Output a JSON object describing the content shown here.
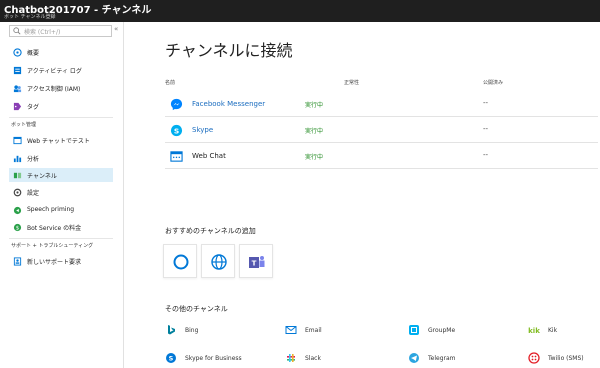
{
  "header": {
    "title": "Chatbot201707 - チャンネル",
    "subtitle": "ボット チャンネル登録"
  },
  "sidebar": {
    "search_placeholder": "検索 (Ctrl+/)",
    "items": [
      {
        "label": "概要",
        "icon": "overview-icon"
      },
      {
        "label": "アクティビティ ログ",
        "icon": "activity-log-icon"
      },
      {
        "label": "アクセス制御 (IAM)",
        "icon": "iam-icon"
      },
      {
        "label": "タグ",
        "icon": "tag-icon"
      }
    ],
    "section_bot": "ボット管理",
    "bot_items": [
      {
        "label": "Web チャットでテスト",
        "icon": "web-chat-test-icon"
      },
      {
        "label": "分析",
        "icon": "analytics-icon"
      },
      {
        "label": "チャンネル",
        "icon": "channels-icon",
        "selected": true
      },
      {
        "label": "設定",
        "icon": "settings-icon"
      },
      {
        "label": "Speech priming",
        "icon": "speech-priming-icon"
      },
      {
        "label": "Bot Service の料金",
        "icon": "pricing-icon"
      }
    ],
    "section_support": "サポート + トラブルシューティング",
    "support_items": [
      {
        "label": "新しいサポート要求",
        "icon": "support-request-icon"
      }
    ]
  },
  "main": {
    "title": "チャンネルに接続",
    "columns": [
      "名前",
      "正常性",
      "公開済み"
    ],
    "channels": [
      {
        "name": "Facebook Messenger",
        "status": "実行中",
        "published": "--",
        "icon": "facebook-messenger-icon",
        "link": true
      },
      {
        "name": "Skype",
        "status": "実行中",
        "published": "--",
        "icon": "skype-icon",
        "link": true
      },
      {
        "name": "Web Chat",
        "status": "実行中",
        "published": "--",
        "icon": "web-chat-icon",
        "link": false
      }
    ],
    "recommended_title": "おすすめのチャンネルの追加",
    "recommended": [
      {
        "icon": "cortana-icon"
      },
      {
        "icon": "globe-icon"
      },
      {
        "icon": "teams-icon"
      }
    ],
    "other_title": "その他のチャンネル",
    "other_channels": [
      {
        "label": "Bing",
        "icon": "bing-icon"
      },
      {
        "label": "Email",
        "icon": "email-icon"
      },
      {
        "label": "GroupMe",
        "icon": "groupme-icon"
      },
      {
        "label": "Kik",
        "icon": "kik-icon"
      },
      {
        "label": "Skype for Business",
        "icon": "skype-for-business-icon"
      },
      {
        "label": "Slack",
        "icon": "slack-icon"
      },
      {
        "label": "Telegram",
        "icon": "telegram-icon"
      },
      {
        "label": "Twilio (SMS)",
        "icon": "twilio-icon"
      }
    ]
  },
  "colors": {
    "topbar": "#1f1f1f",
    "selected": "#dbeef9",
    "link": "#1a6cbf",
    "running": "#228b22",
    "azure_blue": "#0078d7"
  }
}
